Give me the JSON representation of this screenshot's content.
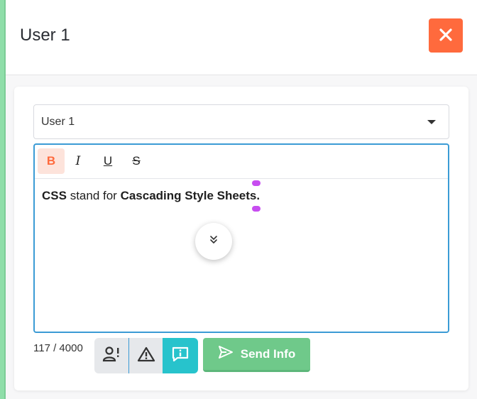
{
  "header": {
    "title": "User 1",
    "close_icon": "close-icon"
  },
  "recipient_select": {
    "selected": "User 1"
  },
  "editor": {
    "toolbar": {
      "bold_label": "B",
      "italic_label": "I",
      "underline_label": "U",
      "strike_label": "S"
    },
    "content": {
      "part1_bold": "CSS",
      "part2": " stand for ",
      "part3_bold": "Cascading Style Sheets."
    },
    "scroll_icon": "double-chevron-down-icon"
  },
  "footer": {
    "char_count": "117 / 4000",
    "send_label": "Send Info"
  },
  "colors": {
    "accent": "#ff6a3d",
    "editor_border": "#3b9bd5",
    "active_type": "#27c3cc",
    "send": "#6fc98a",
    "left_strip": "#8fdea9"
  }
}
